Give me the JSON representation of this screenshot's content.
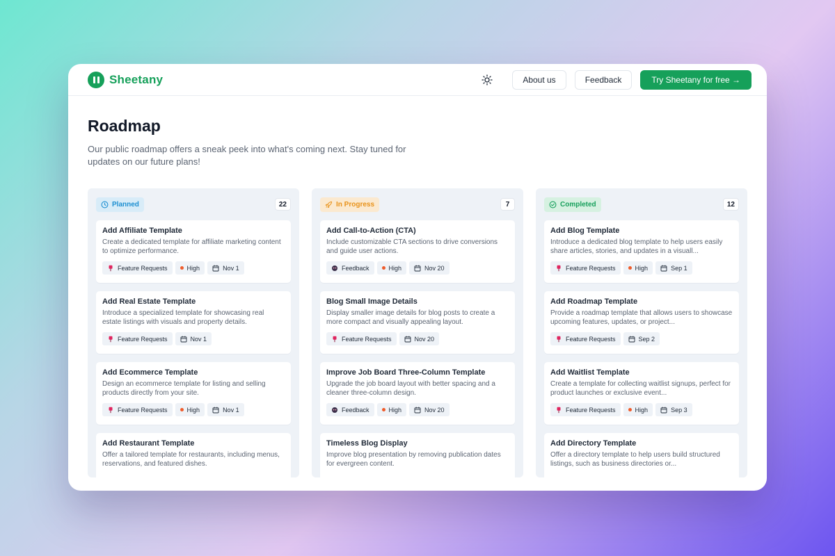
{
  "brand": {
    "name": "Sheetany",
    "color": "#16a05a"
  },
  "nav": {
    "about": "About us",
    "feedback": "Feedback",
    "cta": "Try Sheetany for free →"
  },
  "page": {
    "title": "Roadmap",
    "description": "Our public roadmap offers a sneak peek into what's coming next. Stay tuned for updates on our future plans!"
  },
  "columns": [
    {
      "status": "Planned",
      "count": "22",
      "color": "#1d8fd1",
      "bg": "#d8ecf8",
      "icon": "clock-icon",
      "cards": [
        {
          "title": "Add Affiliate Template",
          "desc": "Create a dedicated template for affiliate marketing content to optimize performance.",
          "category": "Feature Requests",
          "category_icon": "pin-icon",
          "priority": "High",
          "date": "Nov 1"
        },
        {
          "title": "Add Real Estate Template",
          "desc": "Introduce a specialized template for showcasing real estate listings with visuals and property details.",
          "category": "Feature Requests",
          "category_icon": "pin-icon",
          "priority": "",
          "date": "Nov 1"
        },
        {
          "title": "Add Ecommerce Template",
          "desc": "Design an ecommerce template for listing and selling products directly from your site.",
          "category": "Feature Requests",
          "category_icon": "pin-icon",
          "priority": "High",
          "date": "Nov 1"
        },
        {
          "title": "Add Restaurant Template",
          "desc": "Offer a tailored template for restaurants, including menus, reservations, and featured dishes.",
          "category": "",
          "category_icon": "",
          "priority": "",
          "date": ""
        }
      ]
    },
    {
      "status": "In Progress",
      "count": "7",
      "color": "#e8921a",
      "bg": "#fbe9cf",
      "icon": "rocket-icon",
      "cards": [
        {
          "title": "Add Call-to-Action (CTA)",
          "desc": "Include customizable CTA sections to drive conversions and guide user actions.",
          "category": "Feedback",
          "category_icon": "chat-icon",
          "priority": "High",
          "date": "Nov 20"
        },
        {
          "title": "Blog Small Image Details",
          "desc": "Display smaller image details for blog posts to create a more compact and visually appealing layout.",
          "category": "Feature Requests",
          "category_icon": "pin-icon",
          "priority": "",
          "date": "Nov 20"
        },
        {
          "title": "Improve Job Board Three-Column Template",
          "desc": "Upgrade the job board layout with better spacing and a cleaner three-column design.",
          "category": "Feedback",
          "category_icon": "chat-icon",
          "priority": "High",
          "date": "Nov 20"
        },
        {
          "title": "Timeless Blog Display",
          "desc": "Improve blog presentation by removing publication dates for evergreen content.",
          "category": "",
          "category_icon": "",
          "priority": "",
          "date": ""
        }
      ]
    },
    {
      "status": "Completed",
      "count": "12",
      "color": "#17a05c",
      "bg": "#d6f1e1",
      "icon": "check-circle-icon",
      "cards": [
        {
          "title": "Add Blog Template",
          "desc": "Introduce a dedicated blog template to help users easily share articles, stories, and updates in a visuall...",
          "category": "Feature Requests",
          "category_icon": "pin-icon",
          "priority": "High",
          "date": "Sep 1"
        },
        {
          "title": "Add Roadmap Template",
          "desc": "Provide a roadmap template that allows users to showcase upcoming features, updates, or project...",
          "category": "Feature Requests",
          "category_icon": "pin-icon",
          "priority": "",
          "date": "Sep 2"
        },
        {
          "title": "Add Waitlist Template",
          "desc": "Create a template for collecting waitlist signups, perfect for product launches or exclusive event...",
          "category": "Feature Requests",
          "category_icon": "pin-icon",
          "priority": "High",
          "date": "Sep 3"
        },
        {
          "title": "Add Directory Template",
          "desc": "Offer a directory template to help users build structured listings, such as business directories or...",
          "category": "",
          "category_icon": "",
          "priority": "",
          "date": ""
        }
      ]
    }
  ]
}
